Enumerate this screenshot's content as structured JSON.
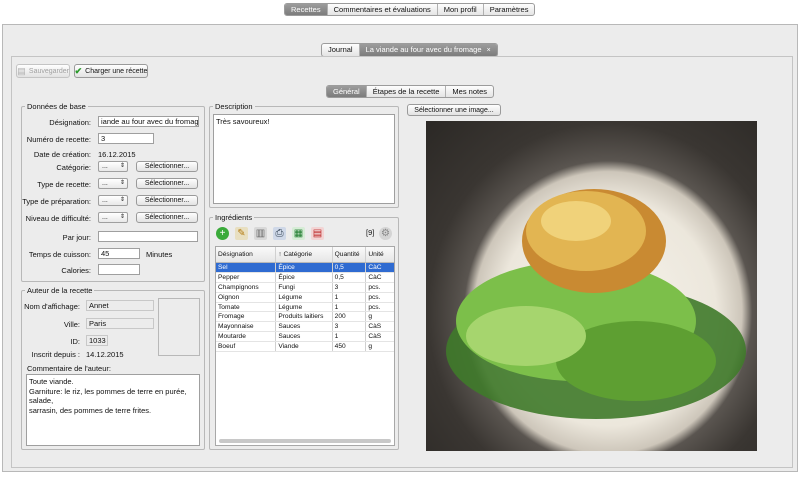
{
  "top_tabs": [
    {
      "label": "Recettes",
      "active": true
    },
    {
      "label": "Commentaires et évaluations",
      "active": false
    },
    {
      "label": "Mon profil",
      "active": false
    },
    {
      "label": "Paramètres",
      "active": false
    }
  ],
  "doc_tabs": [
    {
      "label": "Journal",
      "active": false
    },
    {
      "label": "La viande au four avec du fromage",
      "active": true,
      "close": "×"
    }
  ],
  "toolbar": {
    "save_label": "Sauvegarder",
    "load_label": "Charger une récette"
  },
  "sub_tabs": [
    {
      "label": "Général",
      "active": true
    },
    {
      "label": "Étapes de la recette",
      "active": false
    },
    {
      "label": "Mes notes",
      "active": false
    }
  ],
  "basic": {
    "title": "Données de base",
    "designation_label": "Désignation:",
    "designation_value": "iande au four avec du fromage",
    "number_label": "Numéro de recette:",
    "number_value": "3",
    "created_label": "Date de création:",
    "created_value": "16.12.2015",
    "category_label": "Catégorie:",
    "recipe_type_label": "Type de recette:",
    "prep_type_label": "Type de préparation:",
    "difficulty_label": "Niveau de difficulté:",
    "per_day_label": "Par jour:",
    "cook_time_label": "Temps de cuisson:",
    "cook_time_value": "45",
    "minutes_label": "Minutes",
    "calories_label": "Calories:",
    "combo_value": "...",
    "select_label": "Sélectionner..."
  },
  "author": {
    "title": "Auteur de la recette",
    "name_label": "Nom d'affichage:",
    "name_value": "Annet",
    "city_label": "Ville:",
    "city_value": "Paris",
    "id_label": "ID:",
    "id_value": "1033",
    "since_label": "Inscrit depuis :",
    "since_value": "14.12.2015",
    "comment_label": "Commentaire de l'auteur:",
    "comment_line1": "Toute viande.",
    "comment_line2": "Garniture: le riz, les pommes de terre en purée, salade,",
    "comment_line3": "sarrasin, des pommes de terre frites."
  },
  "description": {
    "title": "Description",
    "text": "Très savoureux!"
  },
  "image": {
    "select_label": "Sélectionner une image..."
  },
  "ingredients": {
    "title": "Ingrédients",
    "count": "[9]",
    "columns": [
      "Désignation",
      "↑ Catégorie",
      "Quantité",
      "Unité"
    ],
    "rows": [
      {
        "name": "Sel",
        "category": "Épice",
        "qty": "0,5",
        "unit": "CàC",
        "selected": true
      },
      {
        "name": "Pepper",
        "category": "Épice",
        "qty": "0,5",
        "unit": "CàC",
        "selected": false
      },
      {
        "name": "Champignons",
        "category": "Fungi",
        "qty": "3",
        "unit": "pcs.",
        "selected": false
      },
      {
        "name": "Oignon",
        "category": "Légume",
        "qty": "1",
        "unit": "pcs.",
        "selected": false
      },
      {
        "name": "Tomate",
        "category": "Légume",
        "qty": "1",
        "unit": "pcs.",
        "selected": false
      },
      {
        "name": "Fromage",
        "category": "Produits laitiers",
        "qty": "200",
        "unit": "g",
        "selected": false
      },
      {
        "name": "Mayonnaise",
        "category": "Sauces",
        "qty": "3",
        "unit": "CàS",
        "selected": false
      },
      {
        "name": "Moutarde",
        "category": "Sauces",
        "qty": "1",
        "unit": "CàS",
        "selected": false
      },
      {
        "name": "Boeuf",
        "category": "Viande",
        "qty": "450",
        "unit": "g",
        "selected": false
      }
    ]
  },
  "colors": {
    "selection": "#2f6bd1",
    "active_tab": "#8a8a8a",
    "panel_bg": "#ececec"
  }
}
